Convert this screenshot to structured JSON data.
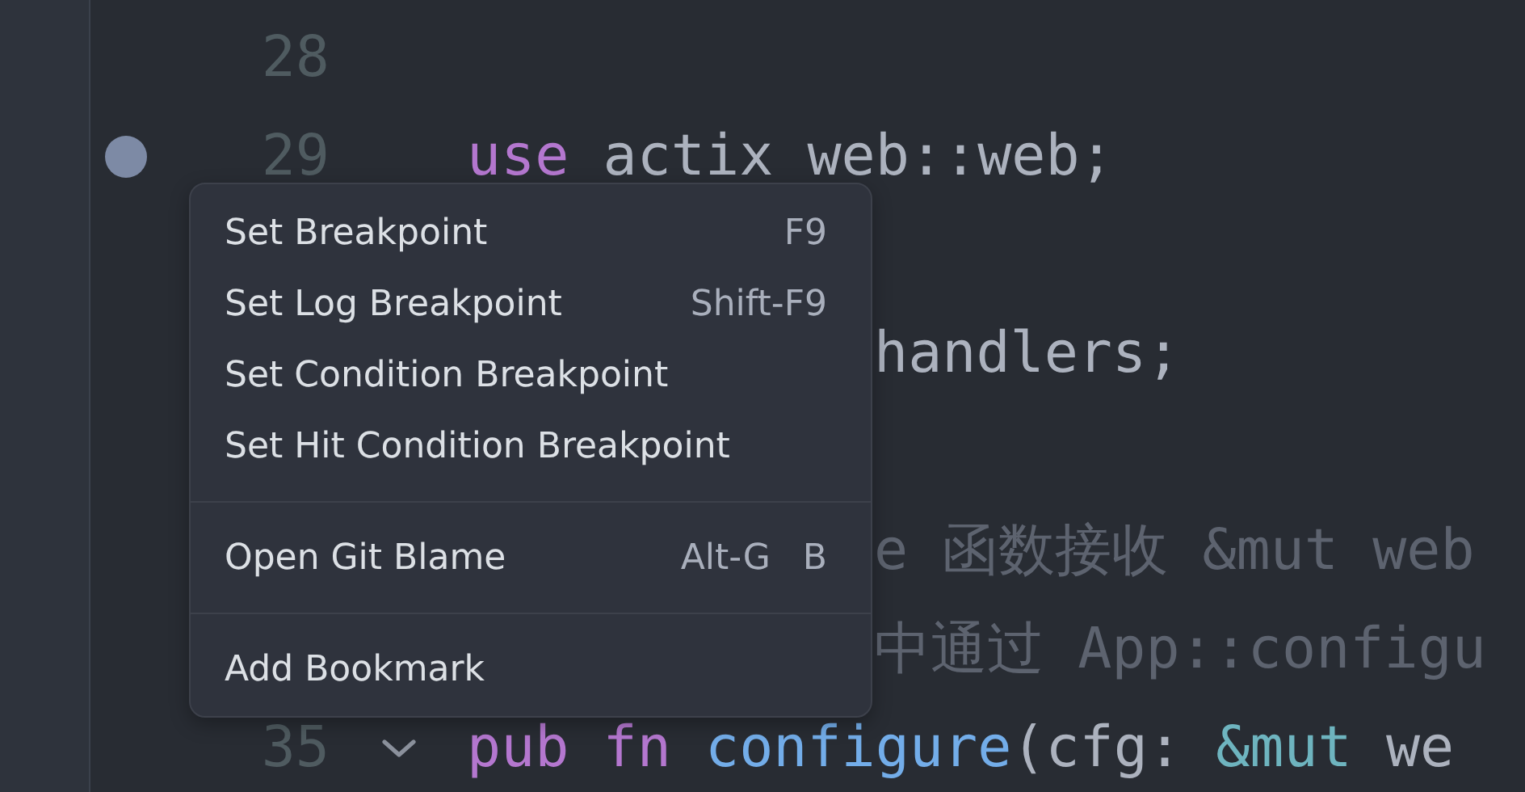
{
  "editor": {
    "lines": [
      {
        "kind": "full",
        "number": "28",
        "breakpoint": false,
        "foldable": false
      },
      {
        "kind": "full",
        "number": "29",
        "breakpoint": true,
        "foldable": false,
        "tokens": [
          {
            "kind": "keyword",
            "text": "use"
          },
          {
            "kind": "plain",
            "text": " actix web::web;"
          }
        ]
      },
      {
        "kind": "covered"
      },
      {
        "kind": "covered",
        "tokens": [
          {
            "kind": "plain",
            "text": "handlers;"
          }
        ]
      },
      {
        "kind": "covered"
      },
      {
        "kind": "covered",
        "tokens": [
          {
            "kind": "comment",
            "text": "e 函数接收 &mut web"
          }
        ]
      },
      {
        "kind": "covered",
        "tokens": [
          {
            "kind": "comment",
            "text": "中通过 App::configu"
          }
        ]
      },
      {
        "kind": "full",
        "number": "35",
        "breakpoint": false,
        "foldable": true,
        "tokens": [
          {
            "kind": "keyword",
            "text": "pub"
          },
          {
            "kind": "keyword",
            "text": " fn"
          },
          {
            "kind": "function",
            "text": " configure"
          },
          {
            "kind": "plain",
            "text": "(cfg: "
          },
          {
            "kind": "type",
            "text": "&mut"
          },
          {
            "kind": "plain",
            "text": " we"
          }
        ]
      }
    ]
  },
  "context_menu": [
    {
      "kind": "item",
      "label": "Set Breakpoint",
      "shortcut": [
        "F9"
      ]
    },
    {
      "kind": "item",
      "label": "Set Log Breakpoint",
      "shortcut": [
        "Shift-F9"
      ]
    },
    {
      "kind": "item",
      "label": "Set Condition Breakpoint"
    },
    {
      "kind": "item",
      "label": "Set Hit Condition Breakpoint"
    },
    {
      "kind": "separator"
    },
    {
      "kind": "item",
      "label": "Open Git Blame",
      "shortcut": [
        "Alt-G",
        "B"
      ]
    },
    {
      "kind": "separator"
    },
    {
      "kind": "item",
      "label": "Add Bookmark"
    }
  ]
}
